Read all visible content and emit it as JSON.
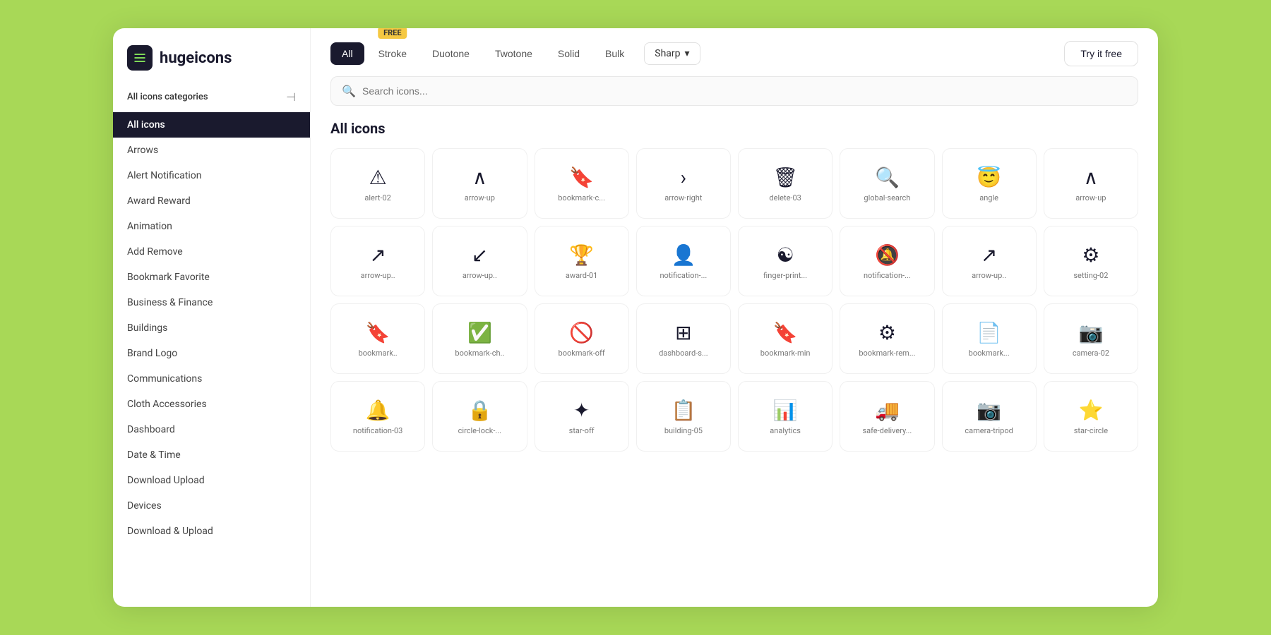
{
  "logo": {
    "text": "hugeicons"
  },
  "sidebar": {
    "header": "All icons categories",
    "collapseIcon": "⊣",
    "items": [
      {
        "label": "All icons",
        "active": true
      },
      {
        "label": "Arrows",
        "active": false
      },
      {
        "label": "Alert Notification",
        "active": false
      },
      {
        "label": "Award Reward",
        "active": false
      },
      {
        "label": "Animation",
        "active": false
      },
      {
        "label": "Add Remove",
        "active": false
      },
      {
        "label": "Bookmark Favorite",
        "active": false
      },
      {
        "label": "Business & Finance",
        "active": false
      },
      {
        "label": "Buildings",
        "active": false
      },
      {
        "label": "Brand Logo",
        "active": false
      },
      {
        "label": "Communications",
        "active": false
      },
      {
        "label": "Cloth Accessories",
        "active": false
      },
      {
        "label": "Dashboard",
        "active": false
      },
      {
        "label": "Date & Time",
        "active": false
      },
      {
        "label": "Download Upload",
        "active": false
      },
      {
        "label": "Devices",
        "active": false
      },
      {
        "label": "Download & Upload",
        "active": false
      }
    ]
  },
  "topbar": {
    "tabs": [
      {
        "label": "All",
        "active": true
      },
      {
        "label": "Stroke",
        "active": false,
        "hasBadge": true,
        "badge": "FREE"
      },
      {
        "label": "Duotone",
        "active": false
      },
      {
        "label": "Twotone",
        "active": false
      },
      {
        "label": "Solid",
        "active": false
      },
      {
        "label": "Bulk",
        "active": false
      }
    ],
    "styleSelector": "Sharp",
    "tryFreeLabel": "Try it free"
  },
  "search": {
    "placeholder": "Search icons..."
  },
  "content": {
    "title": "All icons",
    "icons": [
      {
        "symbol": "⚠",
        "label": "alert-02"
      },
      {
        "symbol": "∧",
        "label": "arrow-up"
      },
      {
        "symbol": "🔖",
        "label": "bookmark-c..."
      },
      {
        "symbol": "›",
        "label": "arrow-right"
      },
      {
        "symbol": "🗑",
        "label": "delete-03"
      },
      {
        "symbol": "🔍",
        "label": "global-search"
      },
      {
        "symbol": "😇",
        "label": "angle"
      },
      {
        "symbol": "∧",
        "label": "arrow-up"
      },
      {
        "symbol": "↗",
        "label": "arrow-up.."
      },
      {
        "symbol": "↙",
        "label": "arrow-up.."
      },
      {
        "symbol": "🏆",
        "label": "award-01"
      },
      {
        "symbol": "👤",
        "label": "notification-..."
      },
      {
        "symbol": "☯",
        "label": "finger-print..."
      },
      {
        "symbol": "🔕",
        "label": "notification-..."
      },
      {
        "symbol": "↗",
        "label": "arrow-up.."
      },
      {
        "symbol": "⚙",
        "label": "setting-02"
      },
      {
        "symbol": "🔖",
        "label": "bookmark.."
      },
      {
        "symbol": "✅",
        "label": "bookmark-ch.."
      },
      {
        "symbol": "🚫",
        "label": "bookmark-off"
      },
      {
        "symbol": "⊞",
        "label": "dashboard-s..."
      },
      {
        "symbol": "🔖",
        "label": "bookmark-min"
      },
      {
        "symbol": "⚙",
        "label": "bookmark-rem..."
      },
      {
        "symbol": "📄",
        "label": "bookmark..."
      },
      {
        "symbol": "📷",
        "label": "camera-02"
      },
      {
        "symbol": "🔔",
        "label": "notification-03"
      },
      {
        "symbol": "🔒",
        "label": "circle-lock-..."
      },
      {
        "symbol": "✦",
        "label": "star-off"
      },
      {
        "symbol": "📋",
        "label": "building-05"
      },
      {
        "symbol": "📊",
        "label": "analytics"
      },
      {
        "symbol": "🚚",
        "label": "safe-delivery..."
      },
      {
        "symbol": "📷",
        "label": "camera-tripod"
      },
      {
        "symbol": "⭐",
        "label": "star-circle"
      }
    ]
  }
}
